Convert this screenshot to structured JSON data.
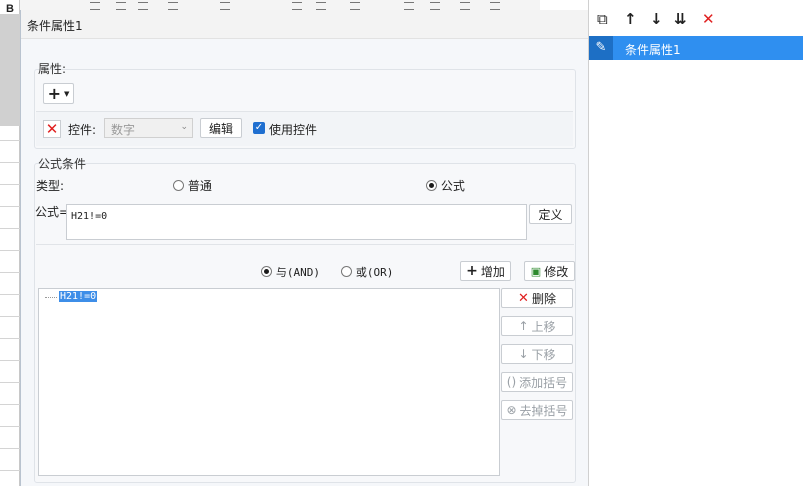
{
  "dialog": {
    "title": "条件属性1",
    "props_group": "属性:",
    "control_label": "控件:",
    "control_select": "数字",
    "edit_btn": "编辑",
    "use_control": "使用控件",
    "formula_group": "公式条件",
    "type_label": "类型:",
    "type_normal": "普通",
    "type_formula": "公式",
    "formula_label": "公式=",
    "formula_value": "H21!=0",
    "define_btn": "定义",
    "logic_and": "与(AND)",
    "logic_or": "或(OR)",
    "add_btn": "增加",
    "modify_btn": "修改",
    "list_items": [
      "H21!=0"
    ],
    "delete_btn": "删除",
    "move_up_btn": "上移",
    "move_down_btn": "下移",
    "add_paren_btn": "添加括号",
    "remove_paren_btn": "去掉括号"
  },
  "right_panel": {
    "items": [
      {
        "label": "条件属性1",
        "selected": true
      }
    ]
  },
  "background": {
    "bold_letter": "B"
  },
  "colors": {
    "accent": "#2f8ff0",
    "delete_red": "#e02020",
    "dialog_bg": "#f5f7fa"
  }
}
